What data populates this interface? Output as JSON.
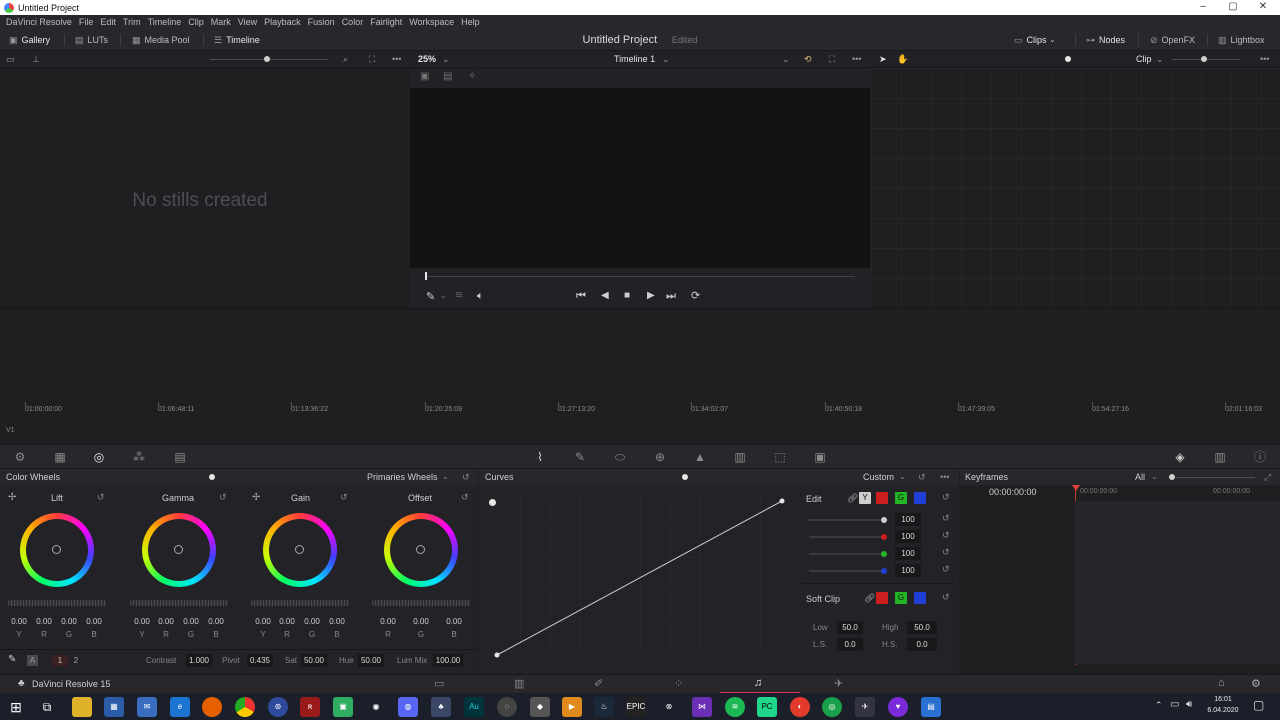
{
  "window": {
    "title": "Untitled Project",
    "min": "–",
    "max": "▢",
    "close": "✕"
  },
  "menu": [
    "DaVinci Resolve",
    "File",
    "Edit",
    "Trim",
    "Timeline",
    "Clip",
    "Mark",
    "View",
    "Playback",
    "Fusion",
    "Color",
    "Fairlight",
    "Workspace",
    "Help"
  ],
  "pagebar": {
    "gallery": "Gallery",
    "luts": "LUTs",
    "media_pool": "Media Pool",
    "timeline": "Timeline",
    "project": "Untitled Project",
    "status": "Edited",
    "clips": "Clips",
    "nodes": "Nodes",
    "openfx": "OpenFX",
    "lightbox": "Lightbox"
  },
  "viewer": {
    "zoom": "25%",
    "timeline_name": "Timeline 1",
    "clip_mode": "Clip"
  },
  "gallery": {
    "empty": "No stills created"
  },
  "timeline": {
    "track": "V1",
    "ticks": [
      "01:00:00:00",
      "01:06:48:11",
      "01:13:36:22",
      "01:20:25:09",
      "01:27:13:20",
      "01:34:02:07",
      "01:40:50:18",
      "01:47:39:05",
      "01:54:27:16",
      "02:01:16:03"
    ]
  },
  "color_wheels": {
    "title": "Color Wheels",
    "mode": "Primaries Wheels",
    "wheels": [
      {
        "name": "Lift",
        "values": [
          "0.00",
          "0.00",
          "0.00",
          "0.00"
        ],
        "labels": [
          "Y",
          "R",
          "G",
          "B"
        ]
      },
      {
        "name": "Gamma",
        "values": [
          "0.00",
          "0.00",
          "0.00",
          "0.00"
        ],
        "labels": [
          "Y",
          "R",
          "G",
          "B"
        ]
      },
      {
        "name": "Gain",
        "values": [
          "0.00",
          "0.00",
          "0.00",
          "0.00"
        ],
        "labels": [
          "Y",
          "R",
          "G",
          "B"
        ]
      },
      {
        "name": "Offset",
        "values": [
          "0.00",
          "0.00",
          "0.00"
        ],
        "labels": [
          "R",
          "G",
          "B"
        ]
      }
    ],
    "footer": {
      "page1": "1",
      "page2": "2",
      "contrast_label": "Contrast",
      "contrast": "1.000",
      "pivot_label": "Pivot",
      "pivot": "0.435",
      "sat_label": "Sat",
      "sat": "50.00",
      "hue_label": "Hue",
      "hue": "50.00",
      "lummix_label": "Lum Mix",
      "lummix": "100.00"
    }
  },
  "curves": {
    "title": "Curves",
    "mode": "Custom",
    "edit_label": "Edit",
    "channels": [
      "Y",
      "R",
      "G",
      "B"
    ],
    "intensity": [
      "100",
      "100",
      "100",
      "100"
    ],
    "softclip_label": "Soft Clip",
    "low_label": "Low",
    "low": "50.0",
    "high_label": "High",
    "high": "50.0",
    "ls_label": "L.S.",
    "ls": "0.0",
    "hs_label": "H.S.",
    "hs": "0.0"
  },
  "keyframes": {
    "title": "Keyframes",
    "filter": "All",
    "tc_left": "00:00:00:00",
    "tc_mid": "00:00:00:00",
    "tc_right": "00:00:00:00"
  },
  "bottom": {
    "app": "DaVinci Resolve 15"
  },
  "taskbar": {
    "time": "16:01",
    "date": "6.04.2020"
  }
}
